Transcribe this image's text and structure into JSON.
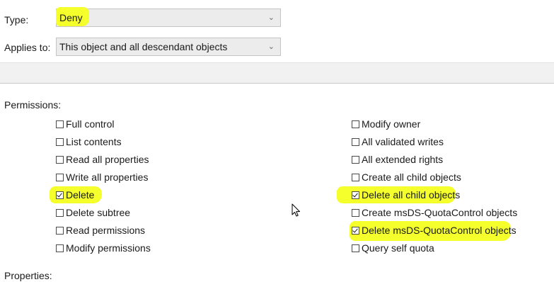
{
  "type_field": {
    "label": "Type:",
    "value": "Deny"
  },
  "applies_field": {
    "label": "Applies to:",
    "value": "This object and all descendant objects"
  },
  "permissions": {
    "label": "Permissions:",
    "left": [
      {
        "label": "Full control",
        "checked": false
      },
      {
        "label": "List contents",
        "checked": false
      },
      {
        "label": "Read all properties",
        "checked": false
      },
      {
        "label": "Write all properties",
        "checked": false
      },
      {
        "label": "Delete",
        "checked": true
      },
      {
        "label": "Delete subtree",
        "checked": false
      },
      {
        "label": "Read permissions",
        "checked": false
      },
      {
        "label": "Modify permissions",
        "checked": false
      }
    ],
    "right": [
      {
        "label": "Modify owner",
        "checked": false
      },
      {
        "label": "All validated writes",
        "checked": false
      },
      {
        "label": "All extended rights",
        "checked": false
      },
      {
        "label": "Create all child objects",
        "checked": false
      },
      {
        "label": "Delete all child objects",
        "checked": true
      },
      {
        "label": "Create msDS-QuotaControl objects",
        "checked": false
      },
      {
        "label": "Delete msDS-QuotaControl objects",
        "checked": true
      },
      {
        "label": "Query self quota",
        "checked": false
      }
    ]
  },
  "properties": {
    "label": "Properties:"
  },
  "highlight_color": "#f4ff2c",
  "icons": {
    "dropdown": "chevron-down-icon",
    "checkbox": "checkbox-icon",
    "cursor": "mouse-cursor-icon"
  }
}
